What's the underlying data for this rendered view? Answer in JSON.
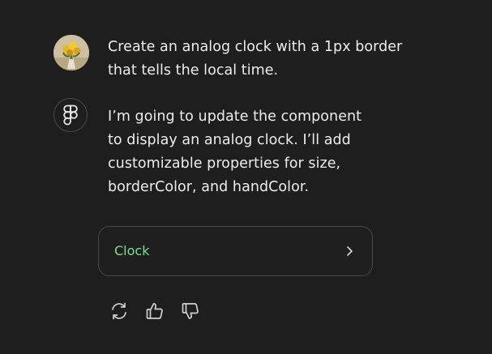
{
  "conversation": {
    "user_message": {
      "avatar": "user-avatar-flowers",
      "lines": [
        "Create an analog clock with a 1px border",
        "that tells the local time."
      ]
    },
    "assistant_message": {
      "icon": "figma-logo-icon",
      "lines": [
        "I’m going to update the component",
        "to display an analog clock. I’ll add",
        "customizable properties for size,",
        "borderColor, and handColor."
      ]
    },
    "component_card": {
      "label": "Clock",
      "icon": "chevron-right-icon"
    },
    "actions": [
      {
        "icon": "regenerate-icon"
      },
      {
        "icon": "thumbs-up-icon"
      },
      {
        "icon": "thumbs-down-icon"
      }
    ]
  },
  "colors": {
    "background": "#1e1e1e",
    "text": "#ededed",
    "accent_green": "#7ddf90",
    "border": "#4a4a4a",
    "icon": "#d0d0d0"
  }
}
